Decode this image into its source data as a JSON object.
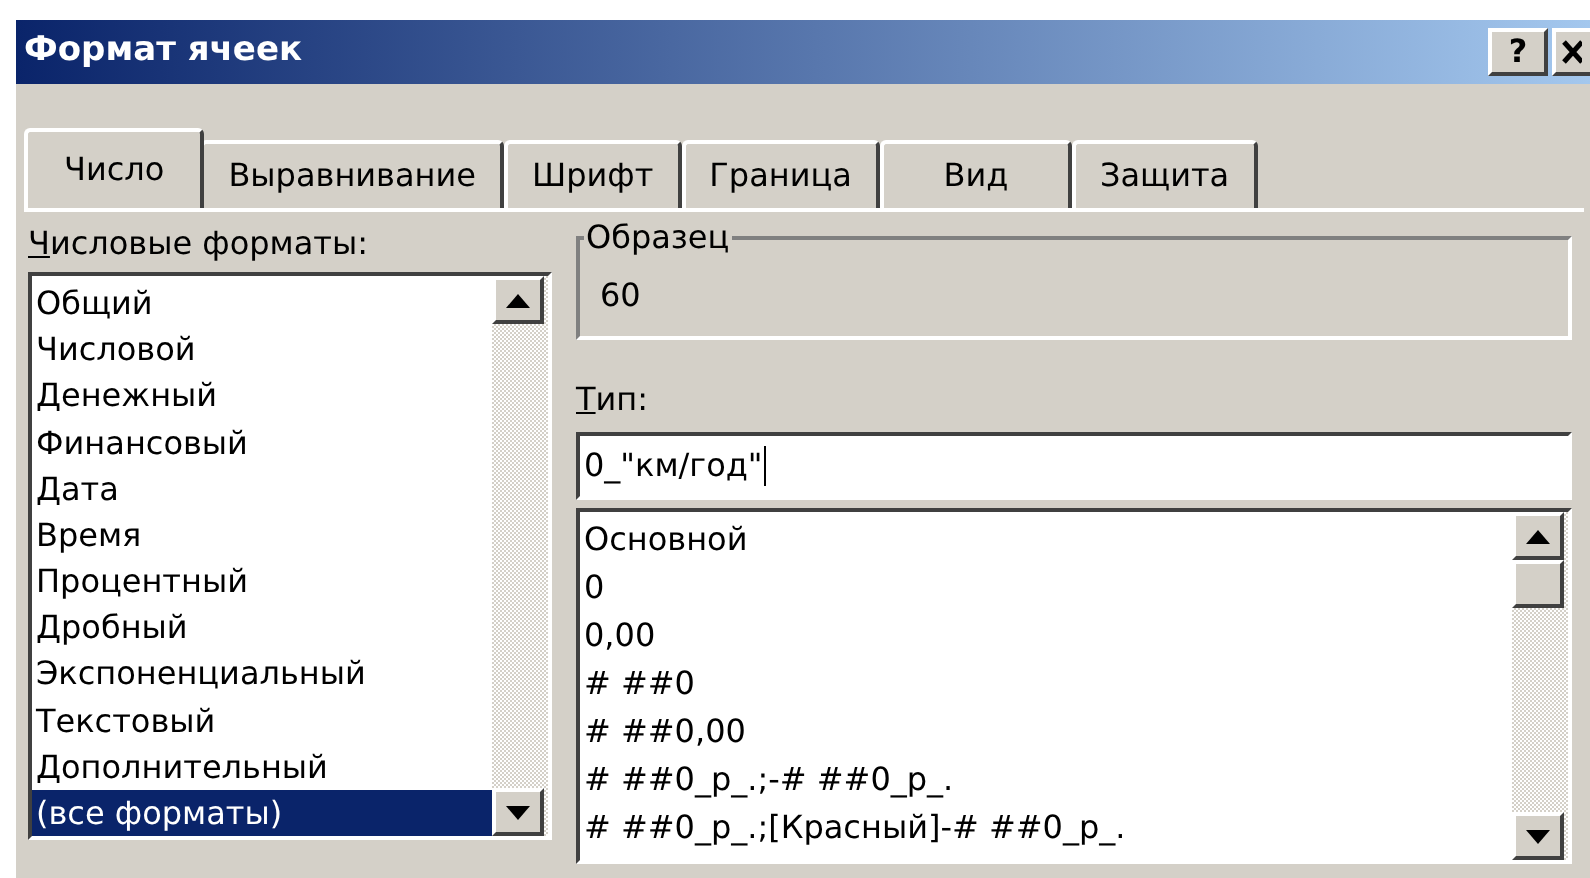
{
  "window": {
    "title": "Формат ячеек",
    "buttons": [
      "?"
    ]
  },
  "tabs": [
    {
      "label": "Число",
      "selected": true
    },
    {
      "label": "Выравнивание",
      "selected": false
    },
    {
      "label": "Шрифт",
      "selected": false
    },
    {
      "label": "Граница",
      "selected": false
    },
    {
      "label": "Вид",
      "selected": false
    },
    {
      "label": "Защита",
      "selected": false
    }
  ],
  "categories": {
    "label": "Числовые форматы:",
    "items": [
      {
        "label": "Общий",
        "selected": false
      },
      {
        "label": "Числовой",
        "selected": false
      },
      {
        "label": "Денежный",
        "selected": false
      },
      {
        "label": "Финансовый",
        "selected": false
      },
      {
        "label": "Дата",
        "selected": false
      },
      {
        "label": "Время",
        "selected": false
      },
      {
        "label": "Процентный",
        "selected": false
      },
      {
        "label": "Дробный",
        "selected": false
      },
      {
        "label": "Экспоненциальный",
        "selected": false
      },
      {
        "label": "Текстовый",
        "selected": false
      },
      {
        "label": "Дополнительный",
        "selected": false
      },
      {
        "label": "(все форматы)",
        "selected": true
      }
    ]
  },
  "sample": {
    "label": "Образец",
    "value": "60"
  },
  "type": {
    "label": "Тип:",
    "value": "0_\"км/год\"",
    "items": [
      "Основной",
      "0",
      "0,00",
      "# ##0",
      "# ##0,00",
      "# ##0_р_.;-# ##0_р_.",
      "# ##0_р_.;[Красный]-# ##0_р_."
    ]
  }
}
